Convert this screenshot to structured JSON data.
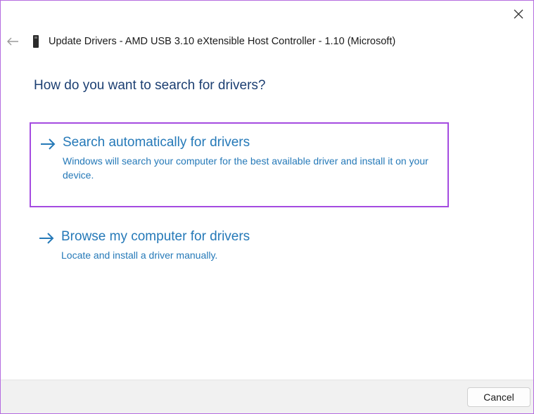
{
  "window": {
    "title": "Update Drivers - AMD USB 3.10 eXtensible Host Controller - 1.10 (Microsoft)",
    "back_icon": "back-arrow-icon",
    "device_icon": "usb-device-icon",
    "close_icon": "close-icon"
  },
  "heading": "How do you want to search for drivers?",
  "options": [
    {
      "title": "Search automatically for drivers",
      "description": "Windows will search your computer for the best available driver and install it on your device.",
      "icon": "arrow-right-icon",
      "highlighted": true
    },
    {
      "title": "Browse my computer for drivers",
      "description": "Locate and install a driver manually.",
      "icon": "arrow-right-icon",
      "highlighted": false
    }
  ],
  "footer": {
    "cancel_label": "Cancel"
  },
  "colors": {
    "heading": "#1c3f72",
    "link": "#2579b8",
    "highlight_border": "#a44be0",
    "window_border": "#b56ce0",
    "footer_bg": "#f1f1f1"
  }
}
